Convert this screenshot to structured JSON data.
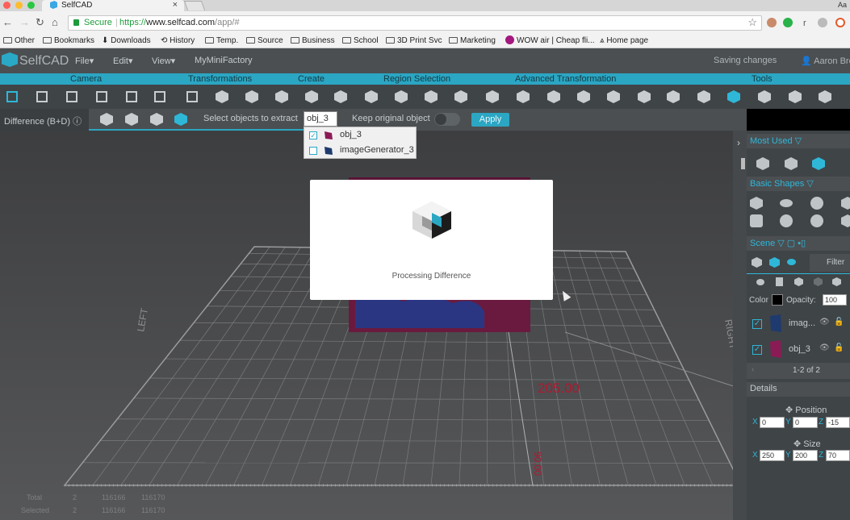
{
  "browser": {
    "tab_title": "SelfCAD",
    "tab_close": "×",
    "profile_initials": "Aa",
    "omnibox": {
      "secure_label": "Secure",
      "url_scheme": "https://",
      "url_host": "www.selfcad.com",
      "url_path": "/app/#"
    },
    "ext_letter": "r",
    "bookmarks": [
      {
        "label": "Other",
        "icon": "folder-icon"
      },
      {
        "label": "Bookmarks",
        "icon": "folder-icon"
      },
      {
        "label": "Downloads",
        "icon": "download-icon"
      },
      {
        "label": "History",
        "icon": "history-icon"
      },
      {
        "label": "Temp.",
        "icon": "folder-icon"
      },
      {
        "label": "Source",
        "icon": "folder-icon"
      },
      {
        "label": "Business",
        "icon": "folder-icon"
      },
      {
        "label": "School",
        "icon": "folder-icon"
      },
      {
        "label": "3D Print Svc",
        "icon": "folder-icon"
      },
      {
        "label": "Marketing",
        "icon": "folder-icon"
      },
      {
        "label": "WOW air | Cheap fli...",
        "icon": "wow-icon"
      },
      {
        "label": "Home page",
        "icon": "home-page-icon"
      }
    ]
  },
  "app": {
    "logo_text": "SelfCAD",
    "menus": [
      "File",
      "Edit",
      "View"
    ],
    "caret": "▾",
    "myminifactory": "MyMiniFactory",
    "saving": "Saving changes",
    "user": "Aaron Bre",
    "groups": [
      "Camera",
      "Transformations",
      "Create",
      "Region Selection",
      "Advanced Transformation",
      "Tools"
    ]
  },
  "subbar": {
    "mode": "Difference (B+D)",
    "select_label": "Select objects to extract",
    "select_value": "obj_3",
    "keep_label": "Keep original object",
    "apply": "Apply",
    "options": [
      {
        "label": "obj_3",
        "checked": true,
        "color": "#8a1b55"
      },
      {
        "label": "imageGenerator_3",
        "checked": false,
        "color": "#1e3a6e"
      }
    ]
  },
  "viewport": {
    "axis_left": "LEFT",
    "axis_right": "RIGHT",
    "dim_width": "205.00",
    "dim_depth": "90.00",
    "stats": {
      "rows": [
        {
          "label": "Total",
          "count": "2",
          "a": "116166",
          "b": "116170"
        },
        {
          "label": "Selected",
          "count": "2",
          "a": "116166",
          "b": "116170"
        }
      ]
    }
  },
  "modal": {
    "text": "Processing Difference"
  },
  "panel": {
    "most_used": "Most Used",
    "basic_shapes": "Basic Shapes",
    "scene": "Scene",
    "filter": "Filter",
    "color_label": "Color",
    "opacity_label": "Opacity:",
    "opacity_value": "100",
    "objects": [
      {
        "name": "imag...",
        "color": "#1e3a6e"
      },
      {
        "name": "obj_3",
        "color": "#8a1b55"
      }
    ],
    "paging": "1-2 of 2",
    "details": "Details",
    "position_label": "Position",
    "position": {
      "x": "0",
      "y": "0",
      "z": "-15"
    },
    "size_label": "Size",
    "size": {
      "x": "250",
      "y": "200",
      "z": "70"
    },
    "axis_x": "X",
    "axis_y": "Y",
    "axis_z": "Z"
  }
}
